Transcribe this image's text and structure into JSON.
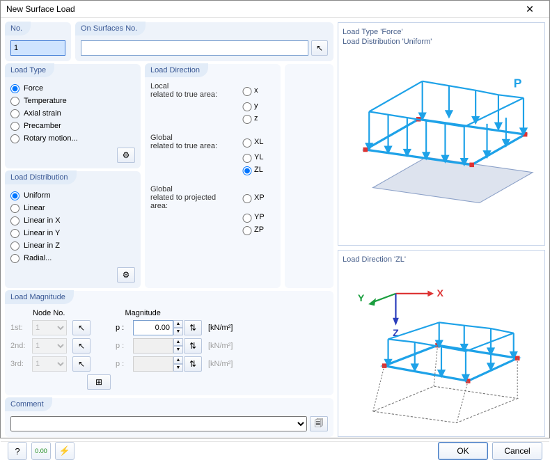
{
  "window": {
    "title": "New Surface Load"
  },
  "fields": {
    "no_label": "No.",
    "no_value": "1",
    "surfaces_label": "On Surfaces No.",
    "surfaces_value": ""
  },
  "load_type": {
    "title": "Load Type",
    "options": [
      {
        "label": "Force",
        "selected": true
      },
      {
        "label": "Temperature",
        "selected": false
      },
      {
        "label": "Axial strain",
        "selected": false
      },
      {
        "label": "Precamber",
        "selected": false
      },
      {
        "label": "Rotary motion...",
        "selected": false
      }
    ]
  },
  "load_distribution": {
    "title": "Load Distribution",
    "options": [
      {
        "label": "Uniform",
        "selected": true
      },
      {
        "label": "Linear",
        "selected": false
      },
      {
        "label": "Linear in X",
        "selected": false
      },
      {
        "label": "Linear in Y",
        "selected": false
      },
      {
        "label": "Linear in Z",
        "selected": false
      },
      {
        "label": "Radial...",
        "selected": false
      }
    ]
  },
  "load_direction": {
    "title": "Load Direction",
    "groups": {
      "local": {
        "hdr1": "Local",
        "hdr2": "related to true area:",
        "opts": [
          "x",
          "y",
          "z"
        ],
        "selected": ""
      },
      "global_true": {
        "hdr1": "Global",
        "hdr2": "related to true area:",
        "opts": [
          "XL",
          "YL",
          "ZL"
        ],
        "selected": "ZL"
      },
      "global_proj": {
        "hdr1": "Global",
        "hdr2": "related to projected",
        "hdr3": "area:",
        "opts": [
          "XP",
          "YP",
          "ZP"
        ],
        "selected": ""
      }
    }
  },
  "load_magnitude": {
    "title": "Load Magnitude",
    "col_node": "Node No.",
    "col_mag": "Magnitude",
    "rows": [
      {
        "label": "1st:",
        "node": "1",
        "p_label": "p :",
        "value": "0.00",
        "unit": "[kN/m²]",
        "enabled": true
      },
      {
        "label": "2nd:",
        "node": "1",
        "p_label": "p :",
        "value": "",
        "unit": "[kN/m²]",
        "enabled": false
      },
      {
        "label": "3rd:",
        "node": "1",
        "p_label": "p :",
        "value": "",
        "unit": "[kN/m²]",
        "enabled": false
      }
    ]
  },
  "comment": {
    "title": "Comment",
    "value": ""
  },
  "preview": {
    "top_line1": "Load Type 'Force'",
    "top_line2": "Load Distribution 'Uniform'",
    "p_label": "P",
    "bottom_title": "Load Direction 'ZL'",
    "axis_x": "X",
    "axis_y": "Y",
    "axis_z": "Z"
  },
  "buttons": {
    "ok": "OK",
    "cancel": "Cancel"
  }
}
